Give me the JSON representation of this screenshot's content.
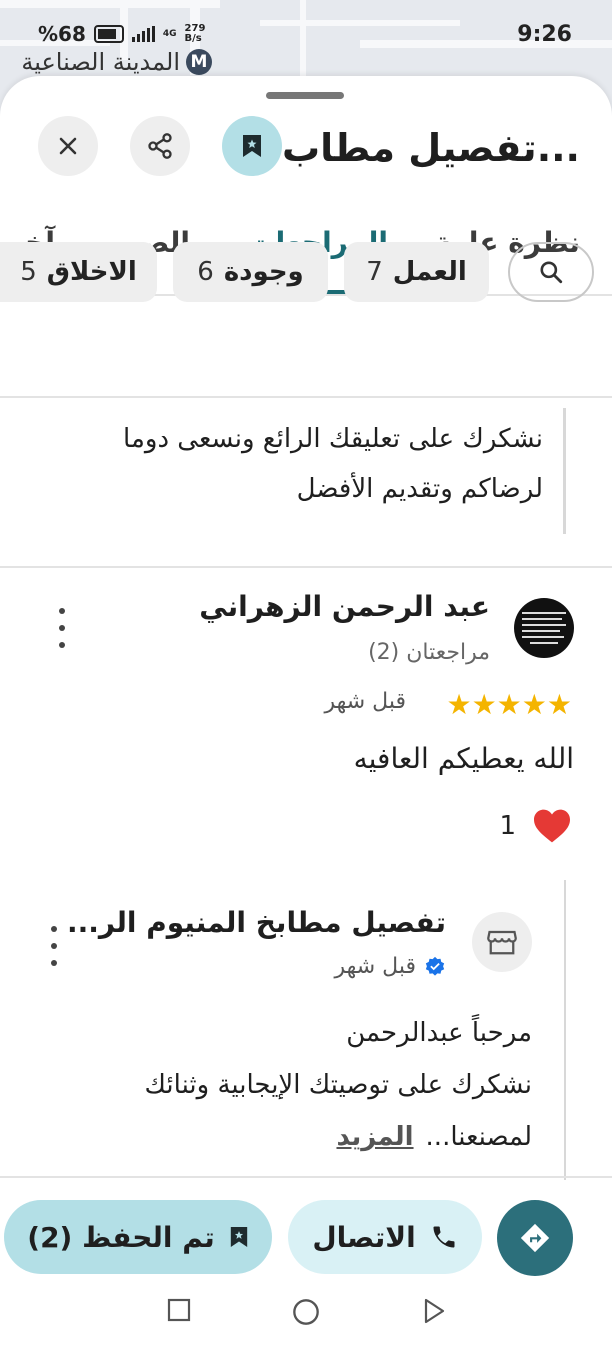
{
  "status_bar": {
    "time": "9:26",
    "battery": "%68",
    "network": "4G",
    "net_speed_value": "279",
    "net_speed_unit": "B/s"
  },
  "map": {
    "metro_letter": "M",
    "place_label": "المدينة الصناعية"
  },
  "header": {
    "title": "تفصيل مطاب..."
  },
  "tabs": [
    {
      "label": "نظرة عامة"
    },
    {
      "label": "المراجعات"
    },
    {
      "label": "الصور"
    },
    {
      "label": "آخر"
    }
  ],
  "filters": [
    {
      "label": "العمل",
      "count": "7"
    },
    {
      "label": "وجودة",
      "count": "6"
    },
    {
      "label": "الاخلاق",
      "count": "5"
    }
  ],
  "previous_reply": {
    "text_line1": "نشكرك على تعليقك الرائع ونسعى دوما",
    "text_line2": "لرضاكم وتقديم الأفضل"
  },
  "review": {
    "author": "عبد الرحمن الزهراني",
    "reviews_count": "مراجعتان (2)",
    "rating": 5,
    "time": "قبل شهر",
    "text": "الله يعطيكم العافيه",
    "reaction_count": "1"
  },
  "owner_reply": {
    "name": "تفصيل مطابخ المنيوم الر...",
    "time": "قبل شهر",
    "line1": "مرحباً عبدالرحمن",
    "line2": "نشكرك على توصيتك الإيجابية وثنائك",
    "line3": "لمصنعنا...",
    "more_label": "المزيد"
  },
  "actions": {
    "saved_label": "تم الحفظ (2)",
    "call_label": "الاتصال"
  },
  "colors": {
    "accent": "#1b6b74",
    "saved_bg": "#b3dfe6",
    "call_bg": "#d9f1f5",
    "directions_bg": "#2c6f7b",
    "star": "#f4b400"
  },
  "icons": [
    "close-icon",
    "share-icon",
    "bookmark-icon",
    "search-icon",
    "heart-icon",
    "store-icon",
    "verified-icon",
    "phone-icon",
    "directions-icon"
  ]
}
